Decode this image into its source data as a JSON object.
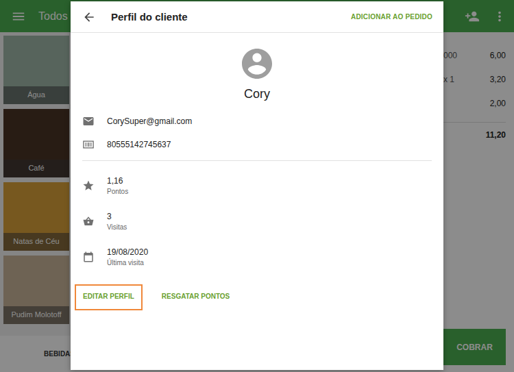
{
  "app": {
    "title": "Todos",
    "products": [
      {
        "label": "Água",
        "color": "#9fb7a8"
      },
      {
        "label": "Café",
        "color": "#4a3326"
      },
      {
        "label": "Natas de Céu",
        "color": "#d9a13a"
      },
      {
        "label": "Pudim Molotoff",
        "color": "#c9b59a"
      }
    ],
    "category": "BEBIDAS",
    "ticket": {
      "lines": [
        {
          "name": "000",
          "price": "6,00"
        },
        {
          "name": "x 1",
          "price": "3,20"
        },
        {
          "price": "2,00"
        }
      ],
      "total": "11,20"
    },
    "charge_button": "COBRAR"
  },
  "panel": {
    "title": "Perfil do cliente",
    "action": "ADICIONAR AO PEDIDO",
    "name": "Cory",
    "contacts": [
      {
        "kind": "email",
        "value": "CorySuper@gmail.com"
      },
      {
        "kind": "barcode",
        "value": "80555142745637"
      }
    ],
    "stats": [
      {
        "kind": "points",
        "value": "1,16",
        "label": "Pontos"
      },
      {
        "kind": "visits",
        "value": "3",
        "label": "Visitas"
      },
      {
        "kind": "date",
        "value": "19/08/2020",
        "label": "Última visita"
      }
    ],
    "buttons": [
      {
        "label": "EDITAR PERFIL",
        "highlighted": true
      },
      {
        "label": "RESGATAR PONTOS",
        "highlighted": false
      }
    ]
  }
}
